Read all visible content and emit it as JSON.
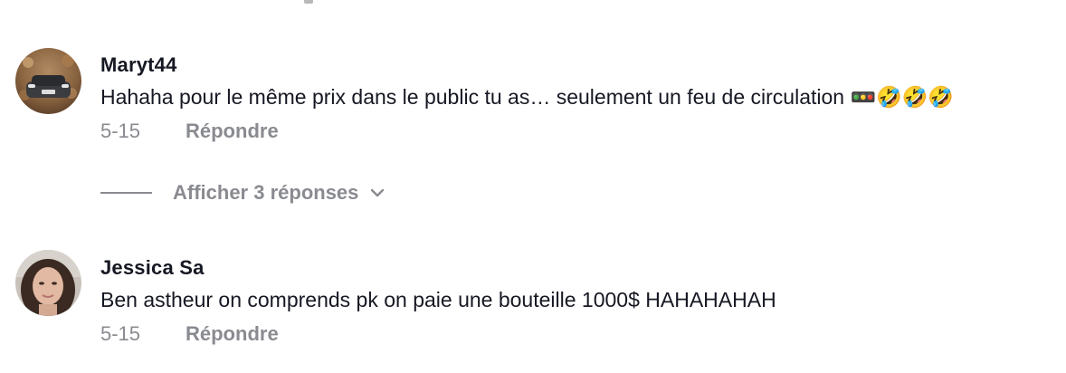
{
  "comments": [
    {
      "username": "Maryt44",
      "text": "Hahaha pour le même prix dans le public tu as… seulement un feu de circulation 🚥🤣🤣🤣",
      "date": "5-15",
      "reply_label": "Répondre",
      "avatar": "car-photo-avatar"
    },
    {
      "username": "Jessica Sa",
      "text": "Ben astheur on comprends pk on paie une bouteille 1000$ HAHAHAHAH",
      "date": "5-15",
      "reply_label": "Répondre",
      "avatar": "woman-photo-avatar"
    }
  ],
  "replies_toggle": {
    "label": "Afficher 3 réponses",
    "icon": "chevron-down-icon"
  },
  "colors": {
    "primary_text": "#161823",
    "secondary_text": "#8a8b91",
    "background": "#ffffff"
  }
}
